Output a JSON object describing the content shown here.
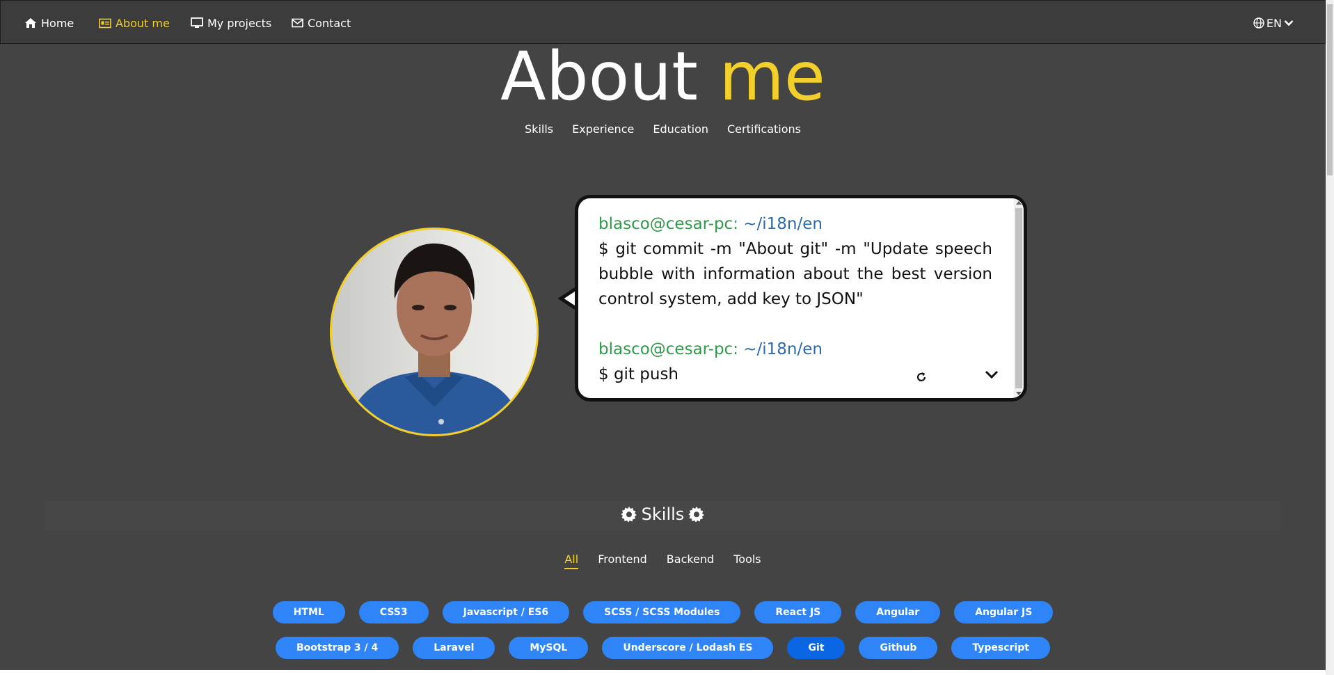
{
  "navbar": {
    "items": [
      {
        "label": "Home",
        "icon": "home-icon",
        "active": false
      },
      {
        "label": "About me",
        "icon": "id-card-icon",
        "active": true
      },
      {
        "label": "My projects",
        "icon": "monitor-icon",
        "active": false
      },
      {
        "label": "Contact",
        "icon": "envelope-icon",
        "active": false
      }
    ],
    "language": "EN"
  },
  "header": {
    "title_part1": "About",
    "title_part2": "me",
    "subnav": [
      "Skills",
      "Experience",
      "Education",
      "Certifications"
    ]
  },
  "terminal": {
    "user": "blasco@cesar-pc:",
    "path": "~/i18n/en",
    "command1": "$ git commit -m \"About git\" -m \"Update speech bubble with information about the best version control system, add key to JSON\"",
    "command2": "$ git push"
  },
  "skills": {
    "title": "Skills",
    "filters": [
      "All",
      "Frontend",
      "Backend",
      "Tools"
    ],
    "active_filter": "All",
    "row1": [
      "HTML",
      "CSS3",
      "Javascript / ES6",
      "SCSS / SCSS Modules",
      "React JS",
      "Angular",
      "Angular JS"
    ],
    "row2": [
      "Bootstrap 3 / 4",
      "Laravel",
      "MySQL",
      "Underscore / Lodash ES",
      "Git",
      "Github",
      "Typescript"
    ],
    "active_chip": "Git"
  },
  "colors": {
    "background": "#444444",
    "accent": "#f2cf2a",
    "chip": "#2f85f7",
    "chip_active": "#0b66e4",
    "prompt_user": "#2e9a4a",
    "prompt_path": "#2f6aa8"
  }
}
